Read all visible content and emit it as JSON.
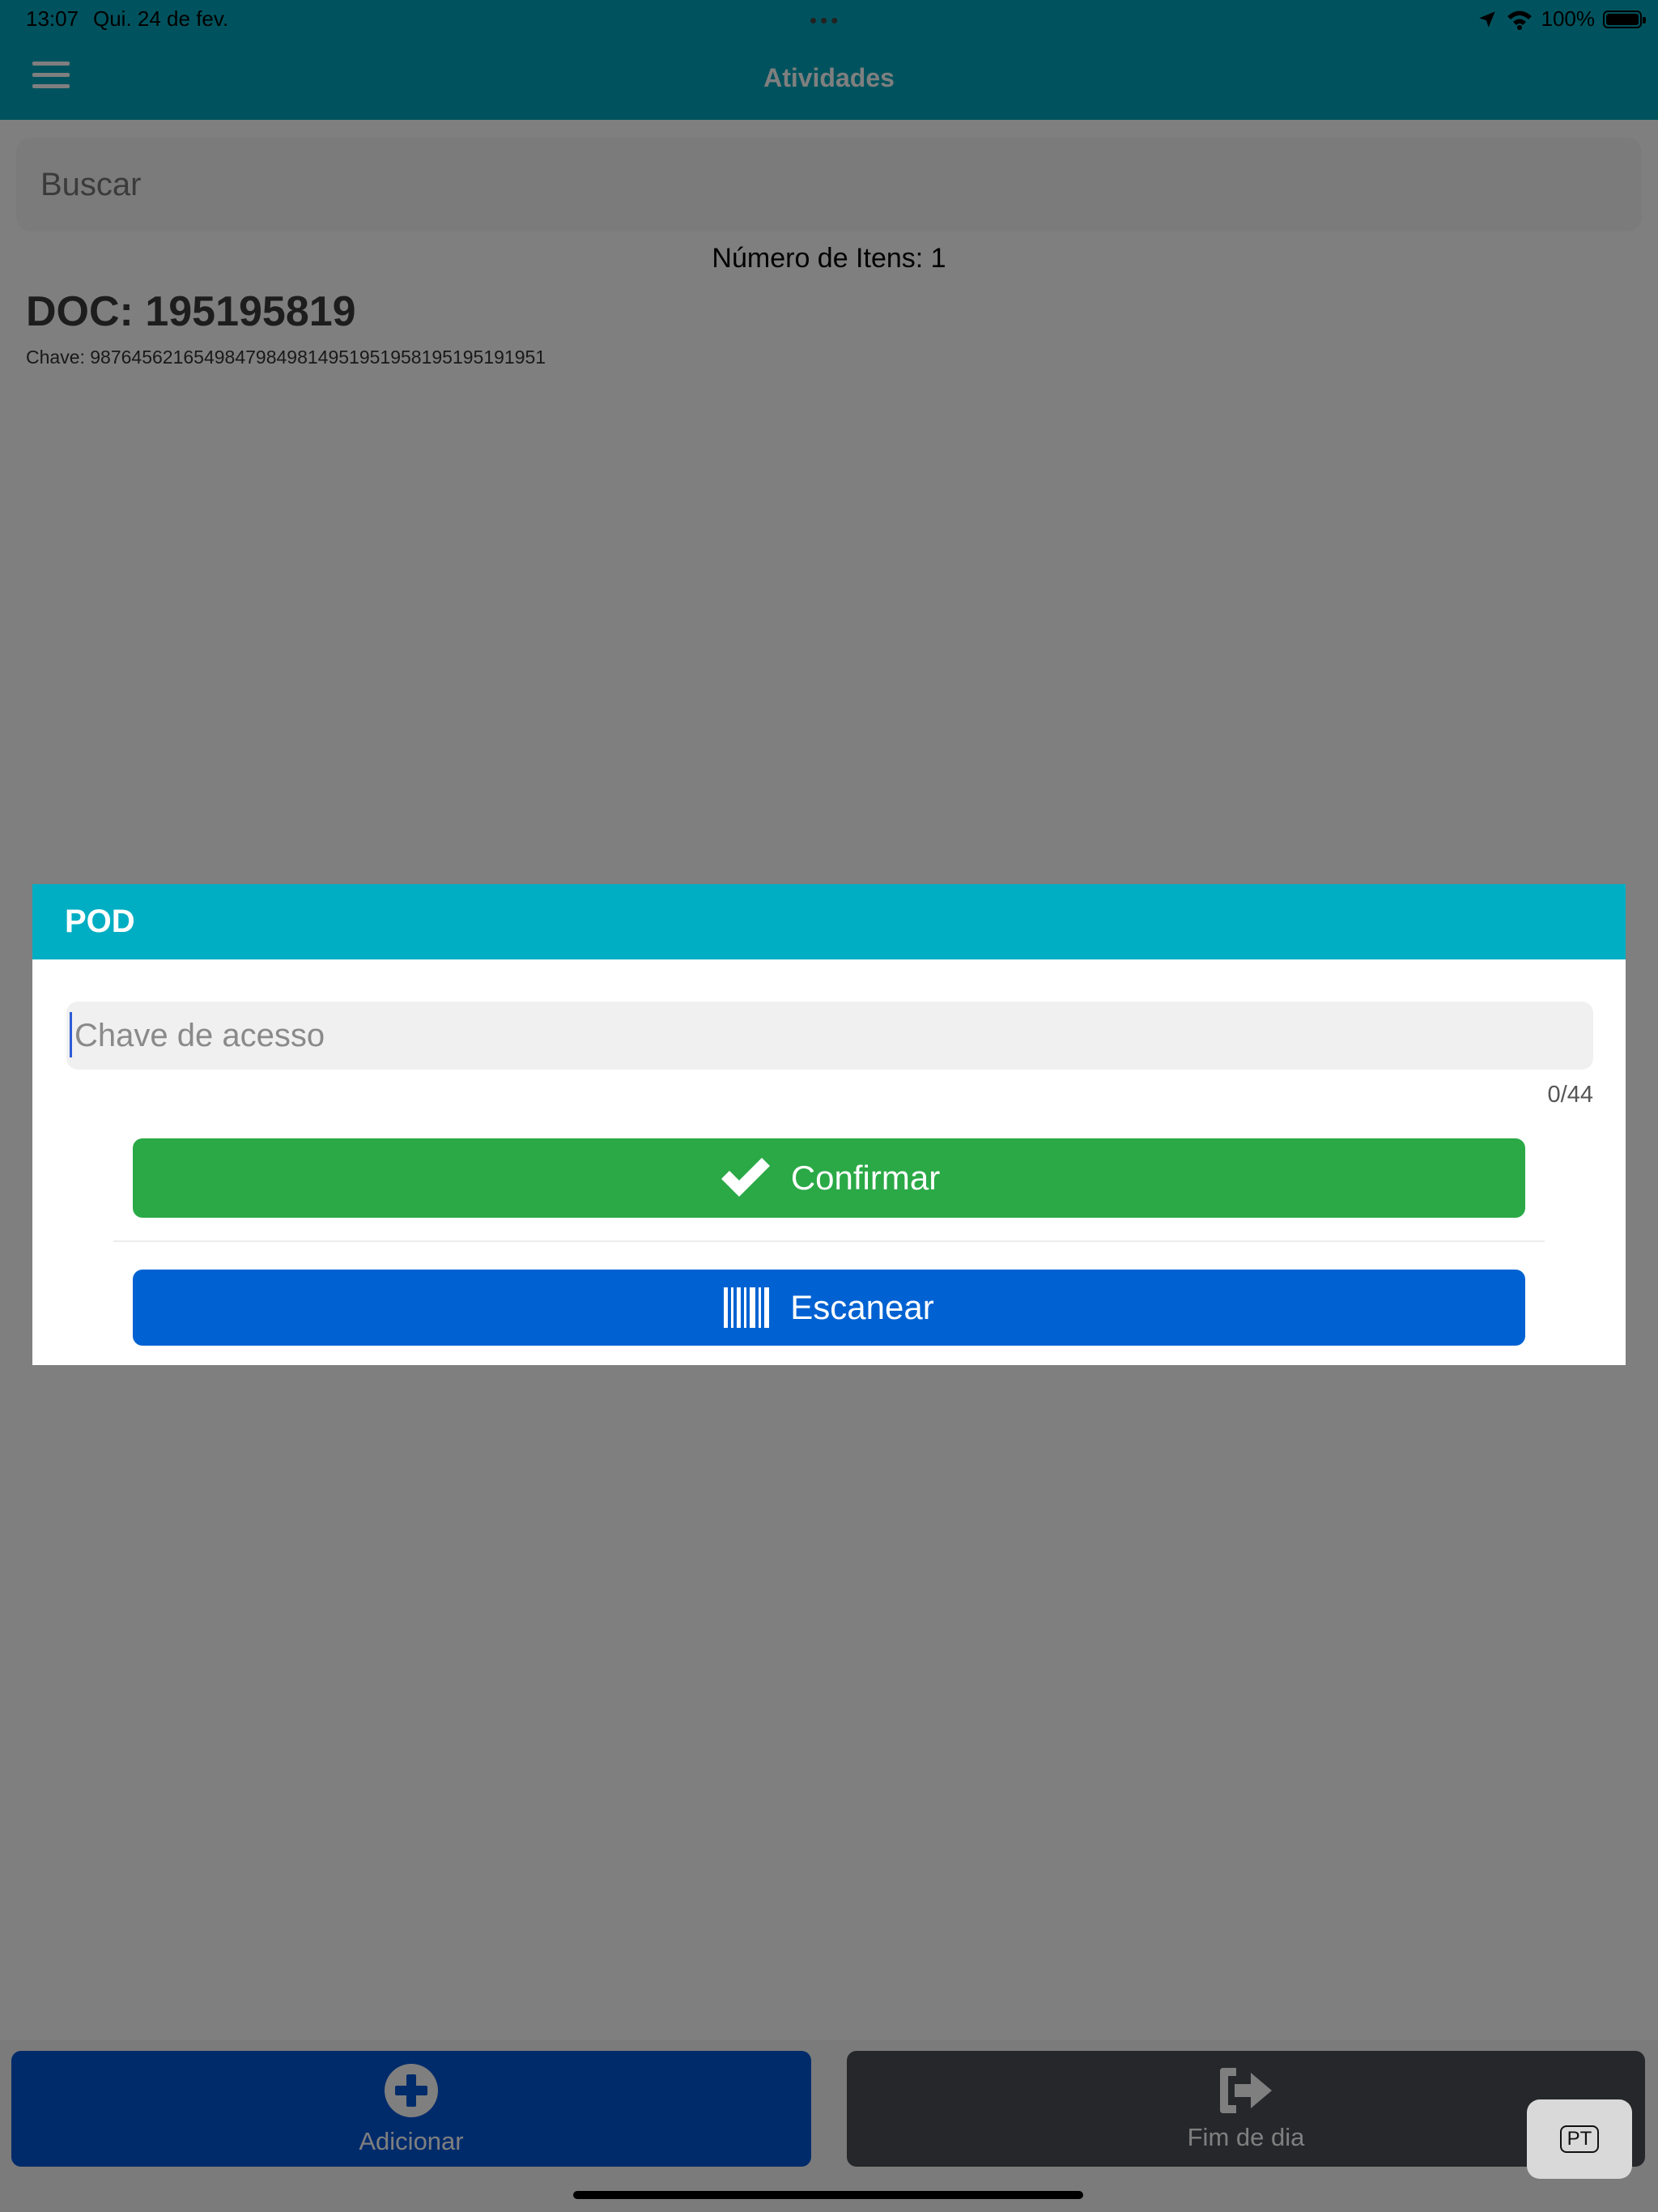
{
  "status_bar": {
    "time": "13:07",
    "date": "Qui. 24 de fev.",
    "dots": "•••",
    "battery": "100%"
  },
  "header": {
    "title": "Atividades",
    "menu_icon": "hamburger-menu-icon"
  },
  "search": {
    "placeholder": "Buscar"
  },
  "list": {
    "count_label": "Número de Itens: 1",
    "items": [
      {
        "doc": "DOC: 195195819",
        "key": "Chave: 98764562165498479849814951951958195195191951"
      }
    ]
  },
  "modal": {
    "title": "POD",
    "input_placeholder": "Chave de acesso",
    "counter": "0/44",
    "confirm_label": "Confirmar",
    "confirm_icon": "checkmark-icon",
    "scan_label": "Escanear",
    "scan_icon": "barcode-icon"
  },
  "bottom_bar": {
    "add_label": "Adicionar",
    "add_icon": "plus-circle-icon",
    "end_label": "Fim de dia",
    "end_icon": "sign-out-icon"
  },
  "language": {
    "code": "PT"
  },
  "colors": {
    "header": "#00a6bd",
    "modal_header": "#00aec3",
    "confirm": "#2aa946",
    "scan": "#0062d2",
    "add_tab": "#0056d6",
    "end_tab": "#4c4f57"
  }
}
